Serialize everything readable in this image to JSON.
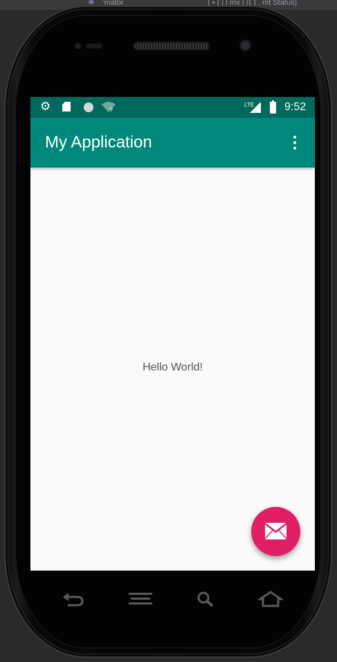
{
  "window_strip": {
    "left_text": "‘mator",
    "right_text": "( • ( | | mx | (( ) , mt Status)"
  },
  "statusbar": {
    "time": "9:52",
    "network_label": "LTE",
    "icons": [
      "settings-gear-icon",
      "sd-card-icon",
      "circle-notification-icon",
      "wifi-no-internet-icon",
      "lte-signal-icon",
      "battery-icon"
    ]
  },
  "appbar": {
    "title": "My Application",
    "menu_icon": "overflow-menu-icon"
  },
  "content": {
    "text": "Hello World!"
  },
  "fab": {
    "icon": "mail-icon",
    "color": "#e01f66"
  },
  "nav": {
    "buttons": [
      "back-icon",
      "menu-icon",
      "search-icon",
      "home-icon"
    ]
  },
  "colors": {
    "status_bar": "#00695c",
    "app_bar": "#00897b",
    "background": "#fafafa"
  }
}
